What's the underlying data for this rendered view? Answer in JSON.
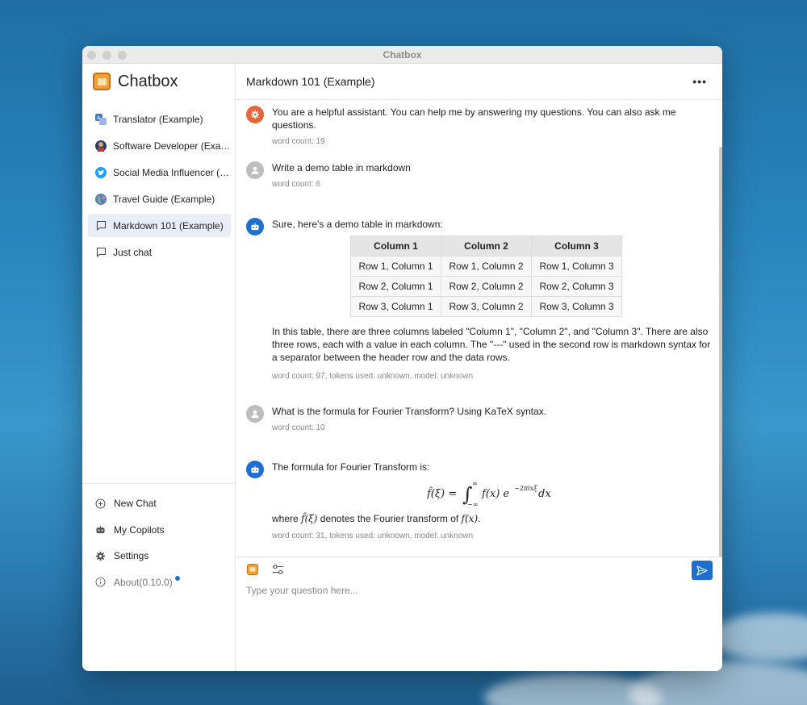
{
  "window": {
    "title": "Chatbox"
  },
  "sidebar": {
    "brand": "Chatbox",
    "sessions": [
      {
        "label": "Translator (Example)",
        "icon": "translator-avatar-icon",
        "color": "#4a78c9"
      },
      {
        "label": "Software Developer (Exam...",
        "icon": "developer-avatar-icon",
        "color": "#c0392b"
      },
      {
        "label": "Social Media Influencer (E...",
        "icon": "twitter-avatar-icon",
        "color": "#1da1f2"
      },
      {
        "label": "Travel Guide (Example)",
        "icon": "globe-avatar-icon",
        "color": "#5b7fb8"
      },
      {
        "label": "Markdown 101 (Example)",
        "icon": "chat-bubble-icon",
        "active": true
      },
      {
        "label": "Just chat",
        "icon": "chat-bubble-icon"
      }
    ],
    "menu": {
      "new_chat": "New Chat",
      "copilots": "My Copilots",
      "settings": "Settings",
      "about": "About(0.10.0)"
    }
  },
  "main": {
    "title": "Markdown 101 (Example)",
    "messages": [
      {
        "role": "system",
        "text": "You are a helpful assistant. You can help me by answering my questions. You can also ask me questions.",
        "meta": "word count: 19"
      },
      {
        "role": "user",
        "text": "Write a demo table in markdown",
        "meta": "word count: 6"
      },
      {
        "role": "assistant",
        "text": "Sure, here's a demo table in markdown:",
        "table": {
          "headers": [
            "Column 1",
            "Column 2",
            "Column 3"
          ],
          "rows": [
            [
              "Row 1, Column 1",
              "Row 1, Column 2",
              "Row 1, Column 3"
            ],
            [
              "Row 2, Column 1",
              "Row 2, Column 2",
              "Row 2, Column 3"
            ],
            [
              "Row 3, Column 1",
              "Row 3, Column 2",
              "Row 3, Column 3"
            ]
          ]
        },
        "after": "In this table, there are three columns labeled \"Column 1\", \"Column 2\", and \"Column 3\". There are also three rows, each with a value in each column. The \"---\" used in the second row is markdown syntax for a separator between the header row and the data rows.",
        "meta": "word count: 97, tokens used: unknown, model: unknown"
      },
      {
        "role": "user",
        "text": "What is the formula for Fourier Transform? Using KaTeX syntax.",
        "meta": "word count: 10"
      },
      {
        "role": "assistant",
        "text": "The formula for Fourier Transform is:",
        "formula": "f̂(ξ) = ∫ f(x) e dx",
        "after_prefix": "where ",
        "after_math1": "f̂(ξ)",
        "after_middle": " denotes the Fourier transform of ",
        "after_math2": "f(x)",
        "after_suffix": ".",
        "meta": "word count: 31, tokens used: unknown, model: unknown"
      }
    ]
  },
  "composer": {
    "placeholder": "Type your question here..."
  }
}
